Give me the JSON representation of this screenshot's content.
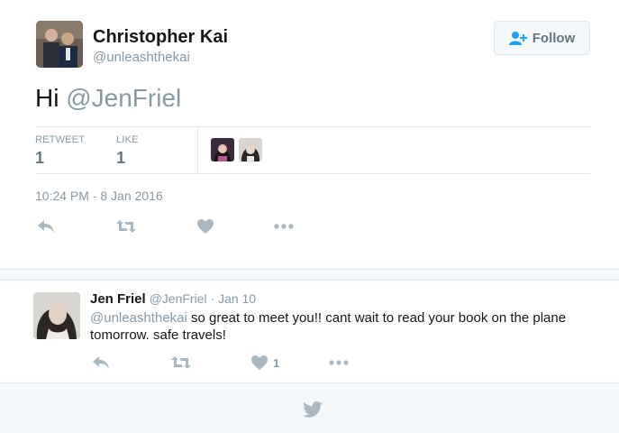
{
  "tweet": {
    "author_name": "Christopher Kai",
    "author_handle": "@unleashthekai",
    "follow_label": "Follow",
    "text_prefix": "Hi ",
    "text_mention": "@JenFriel",
    "retweets_label": "RETWEET",
    "retweets_count": "1",
    "likes_label": "LIKE",
    "likes_count": "1",
    "timestamp": "10:24 PM - 8 Jan 2016",
    "icons": {
      "reply": "reply-icon",
      "retweet": "retweet-icon",
      "like": "heart-icon",
      "more": "more-icon",
      "follow": "add-user-icon"
    }
  },
  "reply": {
    "author_name": "Jen Friel",
    "author_handle": "@JenFriel",
    "separator": "·",
    "date": "Jan 10",
    "text_mention": "@unleashthekai",
    "text_body": " so great to meet you!! cant wait to read your book on the plane tomorrow. safe travels!",
    "likes_count": "1"
  },
  "footer": {
    "icon": "twitter-bird-icon"
  },
  "colors": {
    "text_primary": "#14171a",
    "text_secondary": "#8899a6",
    "icon_gray": "#aab8c2",
    "border": "#e1e8ed",
    "band": "#f5f8fa",
    "follow_icon": "#1da1f2"
  }
}
